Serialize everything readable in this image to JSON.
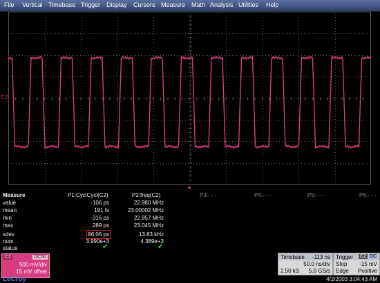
{
  "menu": [
    "File",
    "Vertical",
    "Timebase",
    "Trigger",
    "Display",
    "Cursors",
    "Measure",
    "Math",
    "Analysis",
    "Utilities",
    "Help"
  ],
  "trace": {
    "channel_marker": "C2",
    "color": "#d83c80"
  },
  "measure": {
    "title": "Measure",
    "row_labels": [
      "value",
      "mean",
      "min",
      "max",
      "sdev",
      "num",
      "status"
    ],
    "params": [
      {
        "name": "P1:CyclCycl(C2)",
        "value": "-106 ps",
        "mean": "191 fs",
        "min": "-316 ps",
        "max": "289 ps",
        "sdev": "86.06 ps",
        "num": "3.990e+3",
        "status": "✔"
      },
      {
        "name": "P2:freq(C2)",
        "value": "22.980 MHz",
        "mean": "23.00002 MHz",
        "min": "22.957 MHz",
        "max": "23.045 MHz",
        "sdev": "13.83 kHz",
        "num": "4.389e+3",
        "status": "✔"
      }
    ],
    "empty_params": [
      "P3:- - -",
      "P4:- - -",
      "P5:- - -",
      "P6:- - -"
    ],
    "highlight_color": "#d02020"
  },
  "channel_box": {
    "label": "C2",
    "coupling": "DC50",
    "vdiv": "500 mV/div",
    "offset": "15 mV offset"
  },
  "logo": "LeCroy",
  "timebase": {
    "title": "Timebase",
    "delay": "-113 ns",
    "tdiv": "50.0 ns/div",
    "points": "2.50 kS",
    "rate": "5.0 GS/s"
  },
  "trigger": {
    "title": "Trigger",
    "channel": "C2",
    "coupling": "DC",
    "mode": "Stop",
    "level": "-15 mV",
    "type": "Edge",
    "slope": "Positive"
  },
  "datetime": "4/2/2003 3:04:43 AM",
  "colors": {
    "menubar": "#3c4d80",
    "grid": "#5a5a5a",
    "trace": "#d83c80",
    "status_ok": "#4fd04f"
  }
}
